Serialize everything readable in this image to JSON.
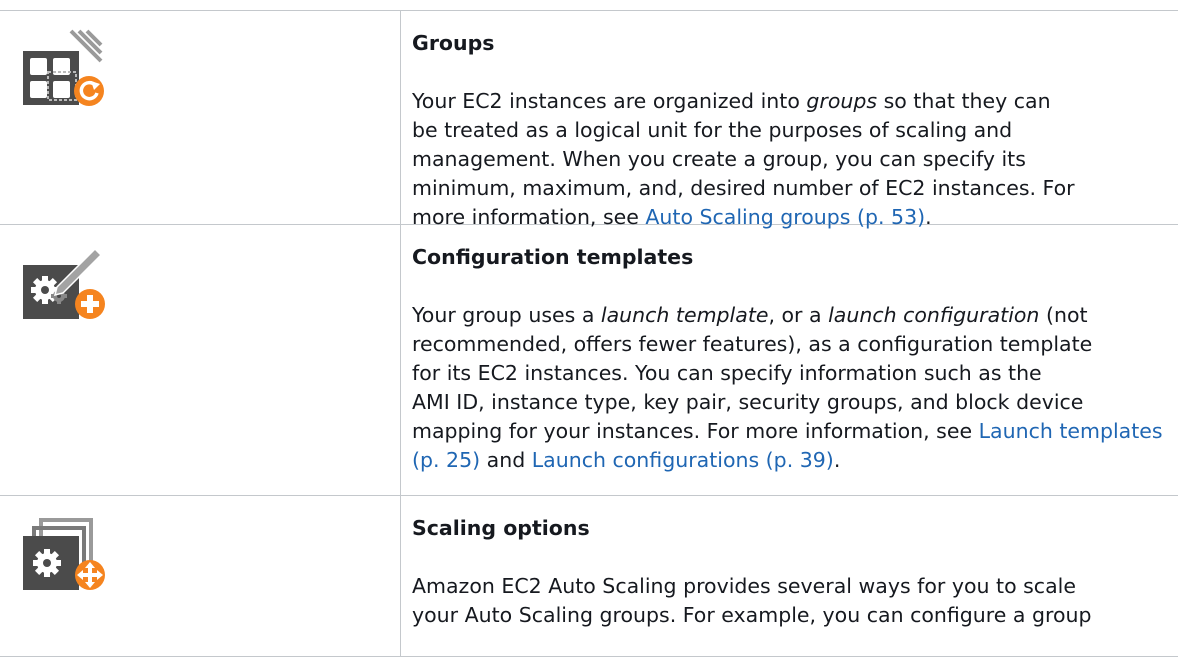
{
  "colors": {
    "icon_dark": "#4b4b4b",
    "icon_accent": "#f5841f",
    "link": "#1f66b3",
    "border": "#c4c8cc"
  },
  "rows": [
    {
      "icon": "auto-scaling-group-icon",
      "heading": "Groups",
      "lines": [
        {
          "pre": "Your EC2 instances are organized into ",
          "em": "groups",
          "post": " so that they can"
        },
        "be treated as a logical unit for the purposes of scaling and",
        "management. When you create a group, you can specify its",
        "minimum, maximum, and, desired number of EC2 instances. For"
      ],
      "last_pre": "more information, see ",
      "link": "Auto Scaling groups (p. 53)",
      "last_post": "."
    },
    {
      "icon": "configuration-template-icon",
      "heading": "Configuration templates",
      "line1": {
        "pre": "Your group uses a ",
        "em1": "launch template",
        "mid": ", or a ",
        "em2": "launch configuration",
        "post": " (not"
      },
      "lines": [
        "recommended, offers fewer features), as a configuration template",
        "for its EC2 instances. You can specify information such as the",
        "AMI ID, instance type, key pair, security groups, and block device"
      ],
      "line5_pre": "mapping for your instances. For more information, see ",
      "link1": "Launch templates (p. 25)",
      "mid": " and ",
      "link2": "Launch configurations (p. 39)",
      "last_post": "."
    },
    {
      "icon": "scaling-options-icon",
      "heading": "Scaling options",
      "lines": [
        "Amazon EC2 Auto Scaling provides several ways for you to scale",
        "your Auto Scaling groups. For example, you can configure a group"
      ]
    }
  ]
}
